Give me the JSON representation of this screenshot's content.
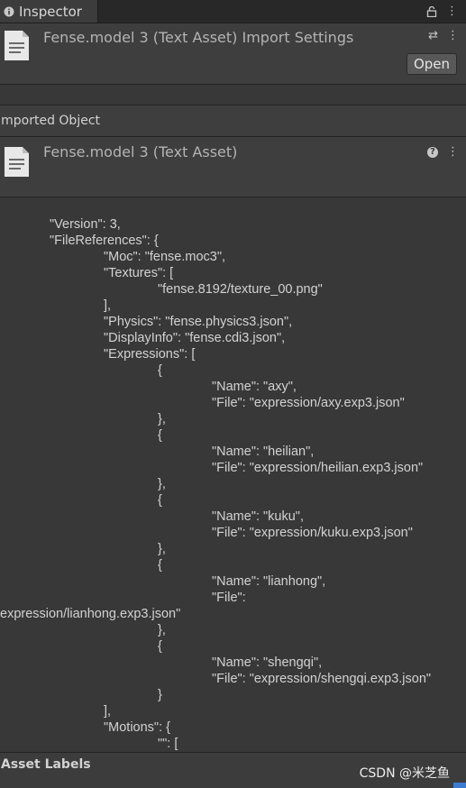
{
  "window": {
    "tab_label": "Inspector",
    "tab_icon": "info-icon",
    "tools": [
      "lock-icon",
      "more-vertical-icon"
    ]
  },
  "import_header": {
    "title": "Fense.model 3 (Text Asset) Import Settings",
    "icons": [
      "settings-sliders-icon",
      "more-vertical-icon"
    ],
    "open_button": "Open"
  },
  "imported_object": {
    "section_label": "Imported Object",
    "title": "Fense.model 3 (Text Asset)",
    "icons": [
      "help-icon",
      "more-vertical-icon"
    ]
  },
  "content_lines": [
    "\"Version\": 3,",
    "\"FileReferences\": {",
    "\"Moc\": \"fense.moc3\",",
    "\"Textures\": [",
    "\"fense.8192/texture_00.png\"",
    "],",
    "\"Physics\": \"fense.physics3.json\",",
    "\"DisplayInfo\": \"fense.cdi3.json\",",
    "\"Expressions\": [",
    "{",
    "\"Name\": \"axy\",",
    "\"File\": \"expression/axy.exp3.json\"",
    "},",
    "{",
    "\"Name\": \"heilian\",",
    "\"File\": \"expression/heilian.exp3.json\"",
    "},",
    "{",
    "\"Name\": \"kuku\",",
    "\"File\": \"expression/kuku.exp3.json\"",
    "},",
    "{",
    "\"Name\": \"lianhong\",",
    "\"File\":",
    "expression/lianhong.exp3.json\"",
    "},",
    "{",
    "\"Name\": \"shengqi\",",
    "\"File\": \"expression/shengqi.exp3.json\"",
    "}",
    "],",
    "\"Motions\": {",
    "\"\": ["
  ],
  "asset_labels": {
    "title": "Asset Labels",
    "watermark": "CSDN @米芝鱼"
  }
}
